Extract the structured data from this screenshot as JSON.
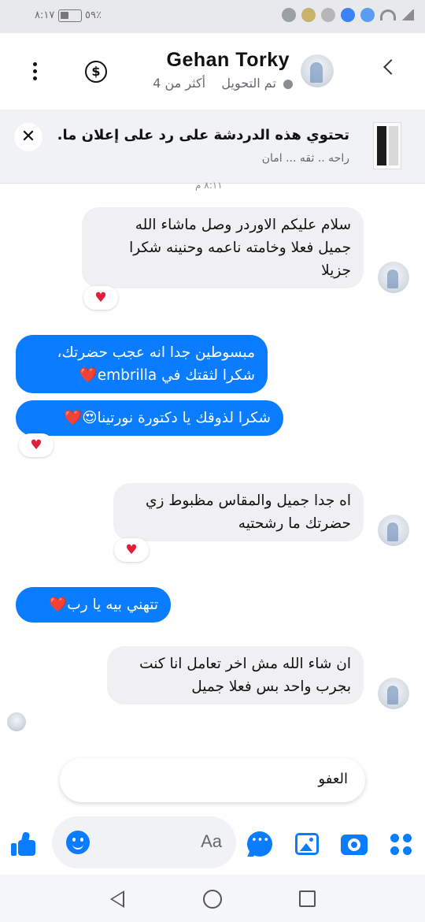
{
  "status_bar": {
    "time": "٨:١٧",
    "battery": "٥٩٪"
  },
  "header": {
    "contact_name": "Gehan Torky",
    "status_text": "تم التحويل",
    "extra_text": "أكثر من 4",
    "icons": [
      "back-icon",
      "avatar",
      "dollar-icon",
      "more-icon"
    ]
  },
  "ad_banner": {
    "title": "تحتوي هذه الدردشة على رد على إعلان ما.",
    "subtitle": "راحه .. ثقه ... امان"
  },
  "conversation": {
    "timestamp": "٨:١١ م",
    "messages": [
      {
        "direction": "in",
        "lines": [
          "سلام عليكم الاوردر وصل ماشاء الله",
          "جميل فعلا وخامته ناعمه وحنينه شكرا",
          "جزيلا"
        ],
        "reaction": "♥"
      },
      {
        "direction": "out",
        "lines": [
          "مبسوطين جدا انه عجب حضرتك،",
          "شكرا لثقتك في embrilla❤️"
        ]
      },
      {
        "direction": "out",
        "lines": [
          "شكرا لذوقك يا دكتورة نورتينا😍❤️"
        ],
        "reaction": "♥"
      },
      {
        "direction": "in",
        "lines": [
          "اه جدا جميل والمقاس مظبوط زي",
          "حضرتك ما رشحتيه"
        ],
        "reaction": "♥"
      },
      {
        "direction": "out",
        "lines": [
          "تتهني بيه يا رب❤️"
        ]
      },
      {
        "direction": "in",
        "lines": [
          "ان شاء الله مش اخر تعامل انا كنت",
          "بجرب واحد بس فعلا جميل"
        ]
      }
    ]
  },
  "suggested_reply": "العفو",
  "composer": {
    "placeholder": "Aa",
    "icons": [
      "like-icon",
      "emoji-icon",
      "chat-icon",
      "image-icon",
      "camera-icon",
      "apps-icon"
    ]
  },
  "navigation": {
    "icons": [
      "nav-back-icon",
      "nav-home-icon",
      "nav-recent-icon"
    ]
  },
  "colors": {
    "accent": "#0a7cff",
    "incoming_bubble": "#f0f0f2",
    "reaction": "#e0203a"
  }
}
